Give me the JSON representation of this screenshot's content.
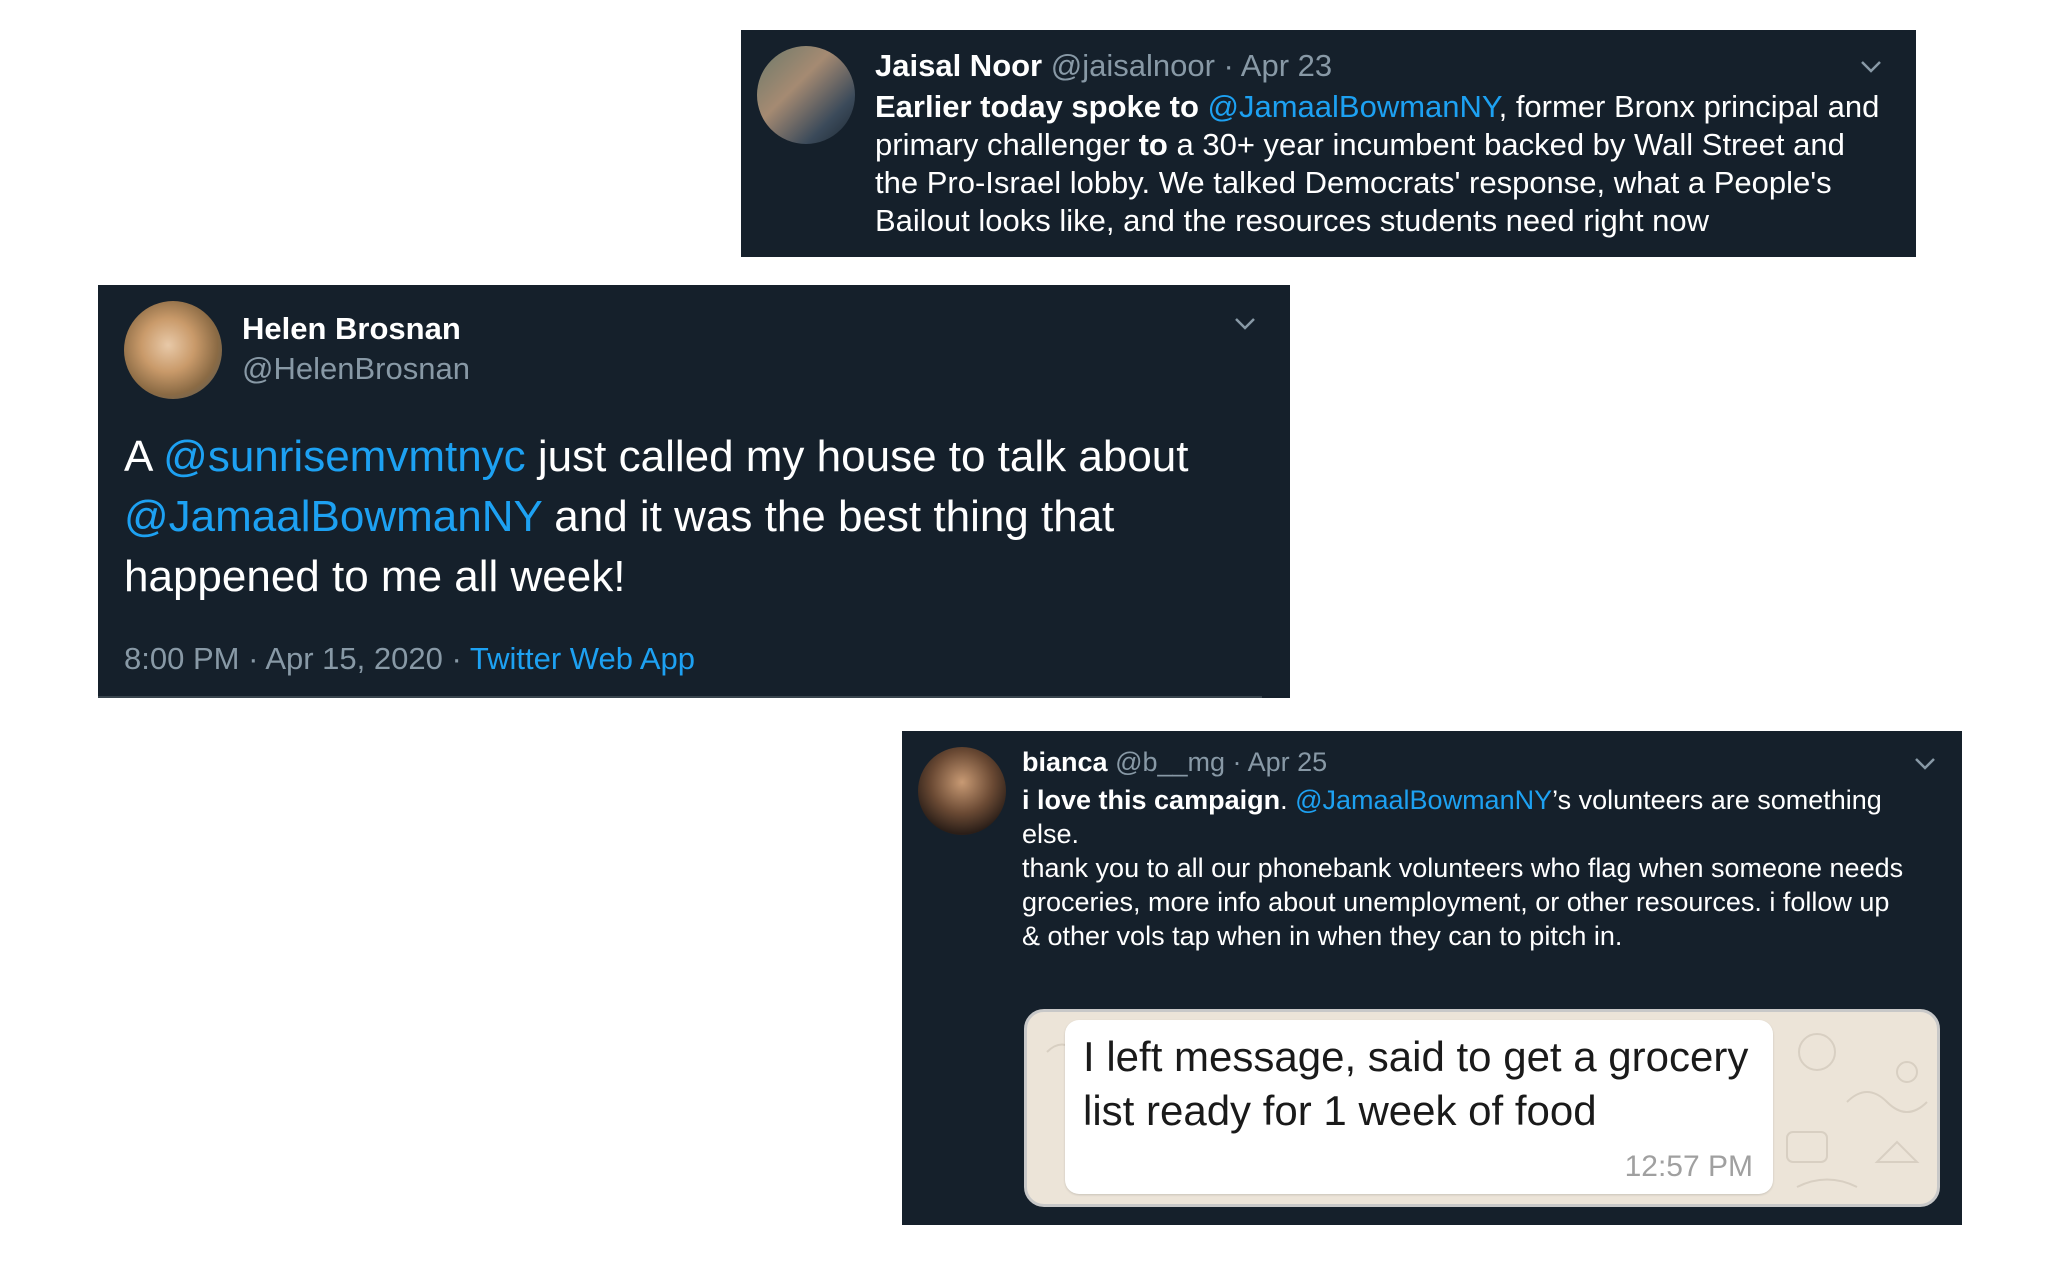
{
  "tweets": [
    {
      "author_name": "Jaisal Noor",
      "handle": "@jaisalnoor",
      "separator": "·",
      "date": "Apr 23",
      "body_lines": [
        [
          {
            "t": "Earlier today spoke to ",
            "s": "b"
          },
          {
            "t": "@JamaalBowmanNY",
            "s": "link"
          },
          {
            "t": ", former Bronx principal and",
            "s": ""
          }
        ],
        [
          {
            "t": "primary challenger ",
            "s": ""
          },
          {
            "t": "to",
            "s": "b"
          },
          {
            "t": " a 30+ year incumbent backed by Wall Street and",
            "s": ""
          }
        ],
        [
          {
            "t": "the Pro-Israel lobby. We talked Democrats' response, what a People's",
            "s": ""
          }
        ],
        [
          {
            "t": "Bailout looks like, and the resources students need right now",
            "s": ""
          }
        ]
      ],
      "avatar_icon": "profile-photo",
      "menu_icon": "chevron-down-icon"
    },
    {
      "author_name": "Helen Brosnan",
      "handle": "@HelenBrosnan",
      "body_lines": [
        [
          {
            "t": "A ",
            "s": ""
          },
          {
            "t": "@sunrisemvmtnyc",
            "s": "link"
          },
          {
            "t": " just called my house to talk about",
            "s": ""
          }
        ],
        [
          {
            "t": "@JamaalBowmanNY",
            "s": "link"
          },
          {
            "t": " and it was the best thing that",
            "s": ""
          }
        ],
        [
          {
            "t": "happened to me all week!",
            "s": ""
          }
        ]
      ],
      "time": "8:00 PM",
      "separator": "·",
      "date": "Apr 15, 2020",
      "source": "Twitter Web App",
      "avatar_icon": "profile-photo",
      "menu_icon": "chevron-down-icon"
    },
    {
      "author_name": "bianca",
      "handle": "@b__mg",
      "separator": "·",
      "date": "Apr 25",
      "body_lines": [
        [
          {
            "t": "i love this campaign",
            "s": "b"
          },
          {
            "t": ". ",
            "s": ""
          },
          {
            "t": "@JamaalBowmanNY",
            "s": "link"
          },
          {
            "t": "’s volunteers are something",
            "s": ""
          }
        ],
        [
          {
            "t": "else.",
            "s": ""
          }
        ],
        [
          {
            "t": " ",
            "s": ""
          }
        ],
        [
          {
            "t": "thank you to all our phonebank volunteers who flag when someone needs",
            "s": ""
          }
        ],
        [
          {
            "t": "groceries, more info about unemployment, or other resources. i follow up",
            "s": ""
          }
        ],
        [
          {
            "t": "& other vols tap when in when they can to pitch in.",
            "s": ""
          }
        ]
      ],
      "embedded_message": {
        "lines": [
          "I left message, said to get a grocery",
          "list ready for 1 week of food"
        ],
        "time": "12:57 PM"
      },
      "avatar_icon": "profile-photo",
      "menu_icon": "chevron-down-icon"
    }
  ],
  "colors": {
    "tweet_background": "#15202b",
    "link": "#1da1f2",
    "muted": "#8899a6",
    "page_background": "#ffffff"
  }
}
